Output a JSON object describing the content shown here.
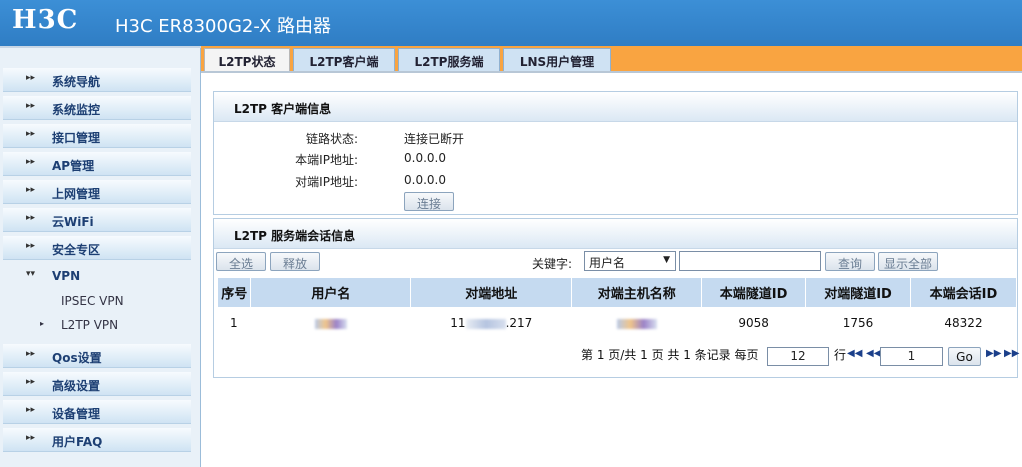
{
  "header": {
    "logo": "H3C",
    "title": "H3C ER8300G2-X 路由器"
  },
  "sidebar": {
    "items": [
      {
        "label": "系统导航"
      },
      {
        "label": "系统监控"
      },
      {
        "label": "接口管理"
      },
      {
        "label": "AP管理"
      },
      {
        "label": "上网管理"
      },
      {
        "label": "云WiFi"
      },
      {
        "label": "安全专区"
      },
      {
        "label": "VPN"
      },
      {
        "label": "Qos设置"
      },
      {
        "label": "高级设置"
      },
      {
        "label": "设备管理"
      },
      {
        "label": "用户FAQ"
      }
    ],
    "vpn_sub": [
      {
        "label": "IPSEC VPN"
      },
      {
        "label": "L2TP VPN"
      }
    ]
  },
  "tabs": [
    {
      "label": "L2TP状态"
    },
    {
      "label": "L2TP客户端"
    },
    {
      "label": "L2TP服务端"
    },
    {
      "label": "LNS用户管理"
    }
  ],
  "client_panel": {
    "title": "L2TP 客户端信息",
    "rows": [
      {
        "label": "链路状态:",
        "value": "连接已断开"
      },
      {
        "label": "本端IP地址:",
        "value": "0.0.0.0"
      },
      {
        "label": "对端IP地址:",
        "value": "0.0.0.0"
      }
    ],
    "connect_button": "连接"
  },
  "server_panel": {
    "title": "L2TP 服务端会话信息",
    "select_all": "全选",
    "release": "释放",
    "keyword_label": "关键字:",
    "keyword_option": "用户名",
    "query": "查询",
    "show_all": "显示全部",
    "columns": [
      "序号",
      "用户名",
      "对端地址",
      "对端主机名称",
      "本端隧道ID",
      "对端隧道ID",
      "本端会话ID"
    ],
    "rows": [
      {
        "idx": "1",
        "peer_addr_prefix": "11",
        "peer_addr_suffix": ".217",
        "local_tunnel": "9058",
        "peer_tunnel": "1756",
        "local_session": "48322"
      }
    ],
    "pager_text": "第 1 页/共 1 页 共 1 条记录 每页",
    "per_page": "12",
    "rows_label": "行",
    "page_input": "1",
    "go": "Go"
  }
}
